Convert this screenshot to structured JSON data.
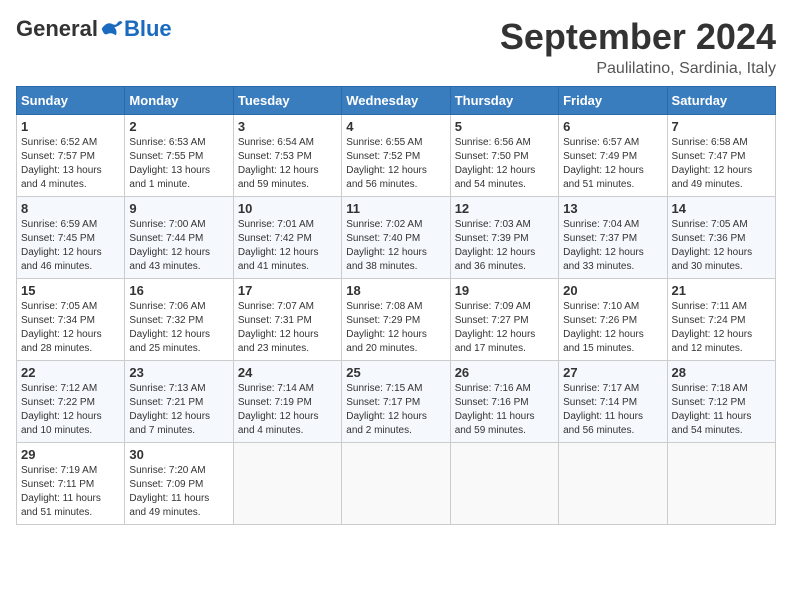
{
  "header": {
    "logo_general": "General",
    "logo_blue": "Blue",
    "month_title": "September 2024",
    "location": "Paulilatino, Sardinia, Italy"
  },
  "columns": [
    "Sunday",
    "Monday",
    "Tuesday",
    "Wednesday",
    "Thursday",
    "Friday",
    "Saturday"
  ],
  "weeks": [
    [
      {
        "day": "1",
        "info": "Sunrise: 6:52 AM\nSunset: 7:57 PM\nDaylight: 13 hours\nand 4 minutes."
      },
      {
        "day": "2",
        "info": "Sunrise: 6:53 AM\nSunset: 7:55 PM\nDaylight: 13 hours\nand 1 minute."
      },
      {
        "day": "3",
        "info": "Sunrise: 6:54 AM\nSunset: 7:53 PM\nDaylight: 12 hours\nand 59 minutes."
      },
      {
        "day": "4",
        "info": "Sunrise: 6:55 AM\nSunset: 7:52 PM\nDaylight: 12 hours\nand 56 minutes."
      },
      {
        "day": "5",
        "info": "Sunrise: 6:56 AM\nSunset: 7:50 PM\nDaylight: 12 hours\nand 54 minutes."
      },
      {
        "day": "6",
        "info": "Sunrise: 6:57 AM\nSunset: 7:49 PM\nDaylight: 12 hours\nand 51 minutes."
      },
      {
        "day": "7",
        "info": "Sunrise: 6:58 AM\nSunset: 7:47 PM\nDaylight: 12 hours\nand 49 minutes."
      }
    ],
    [
      {
        "day": "8",
        "info": "Sunrise: 6:59 AM\nSunset: 7:45 PM\nDaylight: 12 hours\nand 46 minutes."
      },
      {
        "day": "9",
        "info": "Sunrise: 7:00 AM\nSunset: 7:44 PM\nDaylight: 12 hours\nand 43 minutes."
      },
      {
        "day": "10",
        "info": "Sunrise: 7:01 AM\nSunset: 7:42 PM\nDaylight: 12 hours\nand 41 minutes."
      },
      {
        "day": "11",
        "info": "Sunrise: 7:02 AM\nSunset: 7:40 PM\nDaylight: 12 hours\nand 38 minutes."
      },
      {
        "day": "12",
        "info": "Sunrise: 7:03 AM\nSunset: 7:39 PM\nDaylight: 12 hours\nand 36 minutes."
      },
      {
        "day": "13",
        "info": "Sunrise: 7:04 AM\nSunset: 7:37 PM\nDaylight: 12 hours\nand 33 minutes."
      },
      {
        "day": "14",
        "info": "Sunrise: 7:05 AM\nSunset: 7:36 PM\nDaylight: 12 hours\nand 30 minutes."
      }
    ],
    [
      {
        "day": "15",
        "info": "Sunrise: 7:05 AM\nSunset: 7:34 PM\nDaylight: 12 hours\nand 28 minutes."
      },
      {
        "day": "16",
        "info": "Sunrise: 7:06 AM\nSunset: 7:32 PM\nDaylight: 12 hours\nand 25 minutes."
      },
      {
        "day": "17",
        "info": "Sunrise: 7:07 AM\nSunset: 7:31 PM\nDaylight: 12 hours\nand 23 minutes."
      },
      {
        "day": "18",
        "info": "Sunrise: 7:08 AM\nSunset: 7:29 PM\nDaylight: 12 hours\nand 20 minutes."
      },
      {
        "day": "19",
        "info": "Sunrise: 7:09 AM\nSunset: 7:27 PM\nDaylight: 12 hours\nand 17 minutes."
      },
      {
        "day": "20",
        "info": "Sunrise: 7:10 AM\nSunset: 7:26 PM\nDaylight: 12 hours\nand 15 minutes."
      },
      {
        "day": "21",
        "info": "Sunrise: 7:11 AM\nSunset: 7:24 PM\nDaylight: 12 hours\nand 12 minutes."
      }
    ],
    [
      {
        "day": "22",
        "info": "Sunrise: 7:12 AM\nSunset: 7:22 PM\nDaylight: 12 hours\nand 10 minutes."
      },
      {
        "day": "23",
        "info": "Sunrise: 7:13 AM\nSunset: 7:21 PM\nDaylight: 12 hours\nand 7 minutes."
      },
      {
        "day": "24",
        "info": "Sunrise: 7:14 AM\nSunset: 7:19 PM\nDaylight: 12 hours\nand 4 minutes."
      },
      {
        "day": "25",
        "info": "Sunrise: 7:15 AM\nSunset: 7:17 PM\nDaylight: 12 hours\nand 2 minutes."
      },
      {
        "day": "26",
        "info": "Sunrise: 7:16 AM\nSunset: 7:16 PM\nDaylight: 11 hours\nand 59 minutes."
      },
      {
        "day": "27",
        "info": "Sunrise: 7:17 AM\nSunset: 7:14 PM\nDaylight: 11 hours\nand 56 minutes."
      },
      {
        "day": "28",
        "info": "Sunrise: 7:18 AM\nSunset: 7:12 PM\nDaylight: 11 hours\nand 54 minutes."
      }
    ],
    [
      {
        "day": "29",
        "info": "Sunrise: 7:19 AM\nSunset: 7:11 PM\nDaylight: 11 hours\nand 51 minutes."
      },
      {
        "day": "30",
        "info": "Sunrise: 7:20 AM\nSunset: 7:09 PM\nDaylight: 11 hours\nand 49 minutes."
      },
      {
        "day": "",
        "info": ""
      },
      {
        "day": "",
        "info": ""
      },
      {
        "day": "",
        "info": ""
      },
      {
        "day": "",
        "info": ""
      },
      {
        "day": "",
        "info": ""
      }
    ]
  ]
}
